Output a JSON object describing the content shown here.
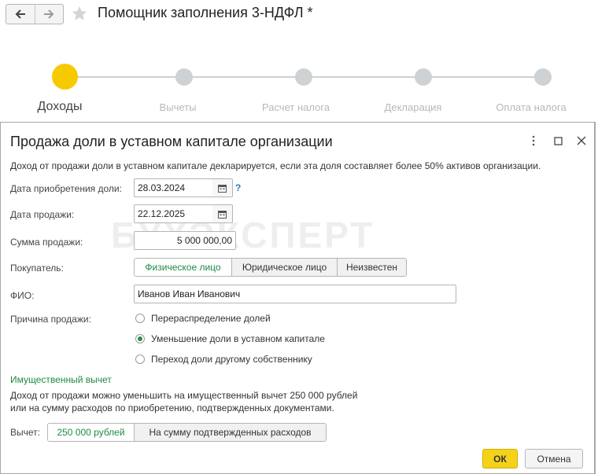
{
  "window": {
    "title": "Помощник заполнения 3-НДФЛ *"
  },
  "steps": [
    {
      "label": "Доходы",
      "active": true
    },
    {
      "label": "Вычеты",
      "active": false
    },
    {
      "label": "Расчет налога",
      "active": false
    },
    {
      "label": "Декларация",
      "active": false
    },
    {
      "label": "Оплата налога",
      "active": false
    }
  ],
  "dialog": {
    "title": "Продажа доли в уставном капитале организации",
    "info": "Доход от продажи доли в уставном капитале декларируется, если эта доля составляет более 50% активов организации.",
    "watermark": "БУХЭКСПЕРТ",
    "fields": {
      "acquisition_date_label": "Дата приобретения доли:",
      "acquisition_date_value": "28.03.2024",
      "help_mark": "?",
      "sale_date_label": "Дата продажи:",
      "sale_date_value": "22.12.2025",
      "sale_amount_label": "Сумма продажи:",
      "sale_amount_value": "5 000 000,00",
      "buyer_label": "Покупатель:",
      "buyer_options": [
        "Физическое лицо",
        "Юридическое лицо",
        "Неизвестен"
      ],
      "buyer_selected": "Физическое лицо",
      "fio_label": "ФИО:",
      "fio_value": "Иванов Иван Иванович",
      "reason_label": "Причина продажи:",
      "reason_options": [
        "Перераспределение долей",
        "Уменьшение доли в уставном капитале",
        "Переход доли другому собственнику"
      ],
      "reason_selected": "Уменьшение доли в уставном капитале"
    },
    "deduction": {
      "title": "Имущественный вычет",
      "text_line1": "Доход от продажи можно уменьшить на имущественный вычет 250 000 рублей",
      "text_line2": "или на сумму расходов по приобретению, подтвержденных документами.",
      "label": "Вычет:",
      "options": [
        "250 000 рублей",
        "На сумму подтвержденных расходов"
      ],
      "selected": "250 000 рублей"
    },
    "buttons": {
      "ok": "ОК",
      "cancel": "Отмена"
    }
  },
  "colors": {
    "accent_yellow": "#f7c900",
    "selected_green": "#1e8a44",
    "link_blue": "#2a7ab8"
  }
}
